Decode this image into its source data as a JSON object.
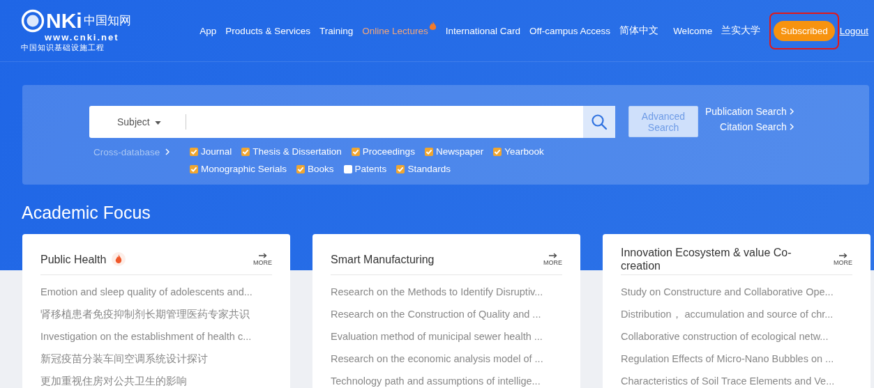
{
  "logo": {
    "mark": "NKi",
    "chinese": "中国知网",
    "url": "www.cnki.net",
    "tagline": "中国知识基础设施工程"
  },
  "nav": [
    {
      "label": "App",
      "hot": false
    },
    {
      "label": "Products & Services",
      "hot": false
    },
    {
      "label": "Training",
      "hot": false
    },
    {
      "label": "Online Lectures",
      "hot": true
    },
    {
      "label": "International Card",
      "hot": false
    },
    {
      "label": "Off-campus Access",
      "hot": false
    },
    {
      "label": "简体中文",
      "hot": false
    }
  ],
  "user": {
    "welcome": "Welcome",
    "name": "兰实大学",
    "subscribed": "Subscribed",
    "subscribed_highlighted": true,
    "logout": "Logout"
  },
  "search": {
    "field": "Subject",
    "advanced": "Advanced Search",
    "publication": "Publication Search",
    "citation": "Citation Search",
    "cross": "Cross-database",
    "databases": [
      {
        "label": "Journal",
        "checked": true
      },
      {
        "label": "Thesis & Dissertation",
        "checked": true
      },
      {
        "label": "Proceedings",
        "checked": true
      },
      {
        "label": "Newspaper",
        "checked": true
      },
      {
        "label": "Yearbook",
        "checked": true
      },
      {
        "label": "Monographic Serials",
        "checked": true
      },
      {
        "label": "Books",
        "checked": true
      },
      {
        "label": "Patents",
        "checked": false
      },
      {
        "label": "Standards",
        "checked": true
      }
    ]
  },
  "focus": {
    "title": "Academic Focus",
    "cards": [
      {
        "title": "Public Health",
        "hot": true,
        "more": "MORE",
        "items": [
          "Emotion and sleep quality of adolescents and...",
          "肾移植患者免疫抑制剂长期管理医药专家共识",
          "Investigation on the establishment of health c...",
          "新冠疫苗分装车间空调系统设计探讨",
          "更加重视住房对公共卫生的影响"
        ]
      },
      {
        "title": "Smart Manufacturing",
        "hot": false,
        "more": "MORE",
        "items": [
          "Research on the Methods to Identify Disruptiv...",
          "Research on the Construction of Quality and ...",
          "Evaluation method of municipal sewer health ...",
          "Research on the economic analysis model of ...",
          "Technology path and assumptions of intellige..."
        ]
      },
      {
        "title": "Innovation Ecosystem & value Co-creation",
        "hot": false,
        "more": "MORE",
        "items": [
          "Study on Constructure and Collaborative Ope...",
          "Distribution， accumulation and source of chr...",
          "Collaborative construction of ecological netw...",
          "Regulation Effects of Micro-Nano Bubbles on ...",
          "Characteristics of Soil Trace Elements and Ve..."
        ]
      }
    ]
  }
}
